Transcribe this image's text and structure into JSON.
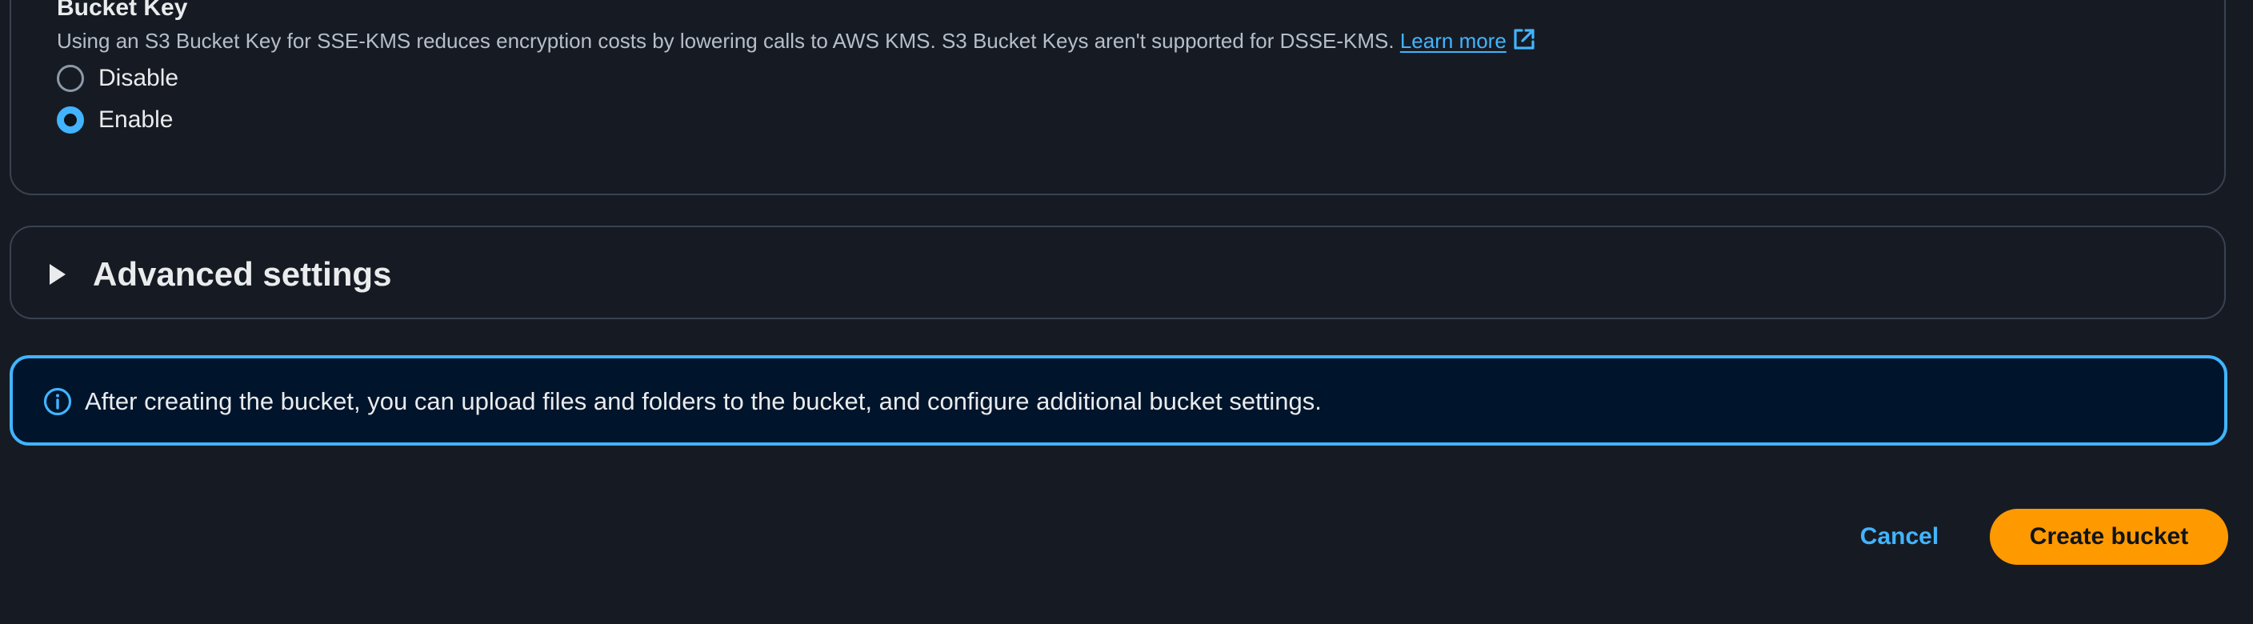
{
  "encryption": {
    "bucket_key": {
      "title": "Bucket Key",
      "description": "Using an S3 Bucket Key for SSE-KMS reduces encryption costs by lowering calls to AWS KMS. S3 Bucket Keys aren't supported for DSSE-KMS.",
      "learn_more": "Learn more",
      "options": [
        {
          "label": "Disable",
          "selected": false
        },
        {
          "label": "Enable",
          "selected": true
        }
      ]
    }
  },
  "advanced_settings": {
    "title": "Advanced settings",
    "expanded": false
  },
  "info_alert": {
    "text": "After creating the bucket, you can upload files and folders to the bucket, and configure additional bucket settings."
  },
  "actions": {
    "cancel_label": "Cancel",
    "create_label": "Create bucket"
  },
  "icons": {
    "external_link": "external-link-icon",
    "info": "info-icon",
    "caret": "caret-right-icon"
  },
  "colors": {
    "accent": "#42b4ff",
    "primary_button": "#ff9900",
    "background": "#161b23",
    "alert_background": "#00142b"
  }
}
